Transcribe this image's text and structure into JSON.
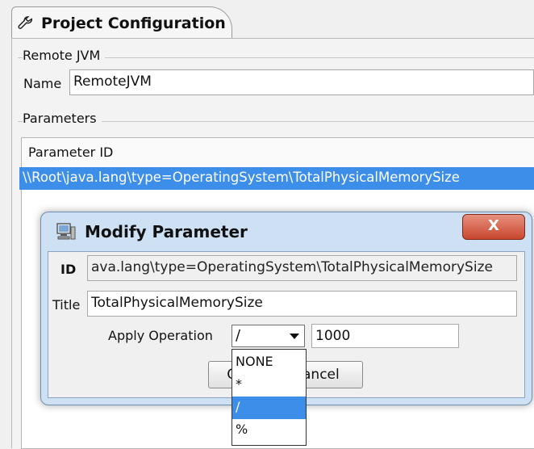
{
  "tab": {
    "title": "Project Configuration",
    "icon": "wrench-icon"
  },
  "remote_jvm": {
    "group_label": "Remote JVM",
    "name_label": "Name",
    "name_value": "RemoteJVM"
  },
  "parameters": {
    "group_label": "Parameters",
    "column_header": "Parameter ID",
    "rows": [
      "\\\\Root\\java.lang\\type=OperatingSystem\\TotalPhysicalMemorySize"
    ]
  },
  "dialog": {
    "title": "Modify Parameter",
    "close_label": "X",
    "id_label": "ID",
    "id_value": "ava.lang\\type=OperatingSystem\\TotalPhysicalMemorySize",
    "title_label": "Title",
    "title_value": "TotalPhysicalMemorySize",
    "apply_label": "Apply Operation",
    "operation_selected": "/",
    "operation_value": "1000",
    "ok_visible": "O",
    "cancel_visible": "ancel"
  },
  "dropdown": {
    "options": [
      "NONE",
      "*",
      "/",
      "%"
    ],
    "selected": "/"
  },
  "colors": {
    "selection": "#3d8ee8",
    "dialog_frame": "#cde0f4",
    "close_button": "#c9462e"
  }
}
